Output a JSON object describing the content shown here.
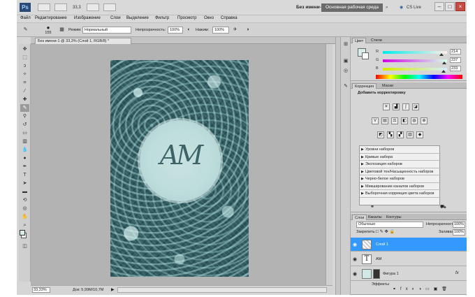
{
  "app": {
    "logo": "Ps",
    "zoom_top": "33,3",
    "document_name": "Без имени-1",
    "workspace": "Основная рабочая среда",
    "cs_live": "CS Live"
  },
  "menu": [
    "Файл",
    "Редактирование",
    "Изображение",
    "Слои",
    "Выделение",
    "Фильтр",
    "Просмотр",
    "Окно",
    "Справка"
  ],
  "options": {
    "brush_size": "155",
    "mode_label": "Режим:",
    "mode_value": "Нормальный",
    "opacity_label": "Непрозрачность:",
    "opacity_value": "100%",
    "flow_label": "Нажим:",
    "flow_value": "100%"
  },
  "document_tab": "Без имени-1 @ 33,3% (Слой 1, RGB/8) *",
  "artwork": {
    "monogram": "AM"
  },
  "status": {
    "zoom": "33,33%",
    "doc_size": "Док: 5,99M/10,7M"
  },
  "color_panel": {
    "tabs": [
      "Цвет",
      "Стили"
    ],
    "channels": [
      {
        "name": "R",
        "value": "214"
      },
      {
        "name": "G",
        "value": "237"
      },
      {
        "name": "B",
        "value": "233"
      }
    ],
    "foreground": "#d6ede9"
  },
  "adjustments_panel": {
    "tabs": [
      "Коррекция",
      "Маски"
    ],
    "header": "Добавить корректировку",
    "presets": [
      "Уровни наборов",
      "Кривые набора",
      "Экспозиция наборов",
      "Цветовой тон/Насыщенность наборов",
      "Черно-белое наборов",
      "Микширование каналов наборов",
      "Выборочная коррекция цвета наборов"
    ]
  },
  "layers_panel": {
    "tabs": [
      "Слои",
      "Каналы",
      "Контуры"
    ],
    "blend_mode": "Обычные",
    "opacity_label": "Непрозрачность:",
    "opacity_value": "100%",
    "lock_label": "Закрепить:",
    "fill_label": "Заливка:",
    "fill_value": "100%",
    "layers": [
      {
        "name": "Слой 1"
      },
      {
        "name": "AM",
        "thumb": "T"
      },
      {
        "name": "Фигура 1",
        "fx": "fx"
      }
    ],
    "effects_label": "Эффекты"
  }
}
